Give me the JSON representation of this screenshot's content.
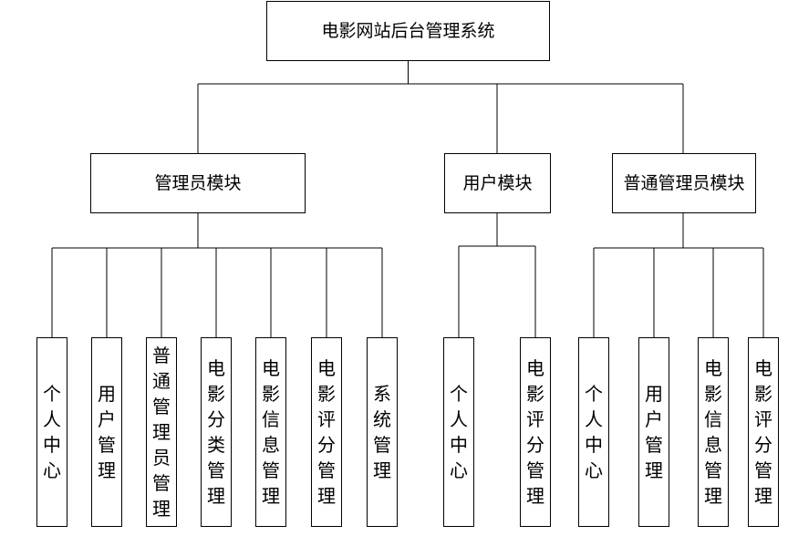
{
  "root": {
    "label": "电影网站后台管理系统"
  },
  "modules": [
    {
      "label": "管理员模块",
      "children": [
        "个人中心",
        "用户管理",
        "普通管理员管理",
        "电影分类管理",
        "电影信息管理",
        "电影评分管理",
        "系统管理"
      ]
    },
    {
      "label": "用户模块",
      "children": [
        "个人中心",
        "电影评分管理"
      ]
    },
    {
      "label": "普通管理员模块",
      "children": [
        "个人中心",
        "用户管理",
        "电影信息管理",
        "电影评分管理"
      ]
    }
  ]
}
